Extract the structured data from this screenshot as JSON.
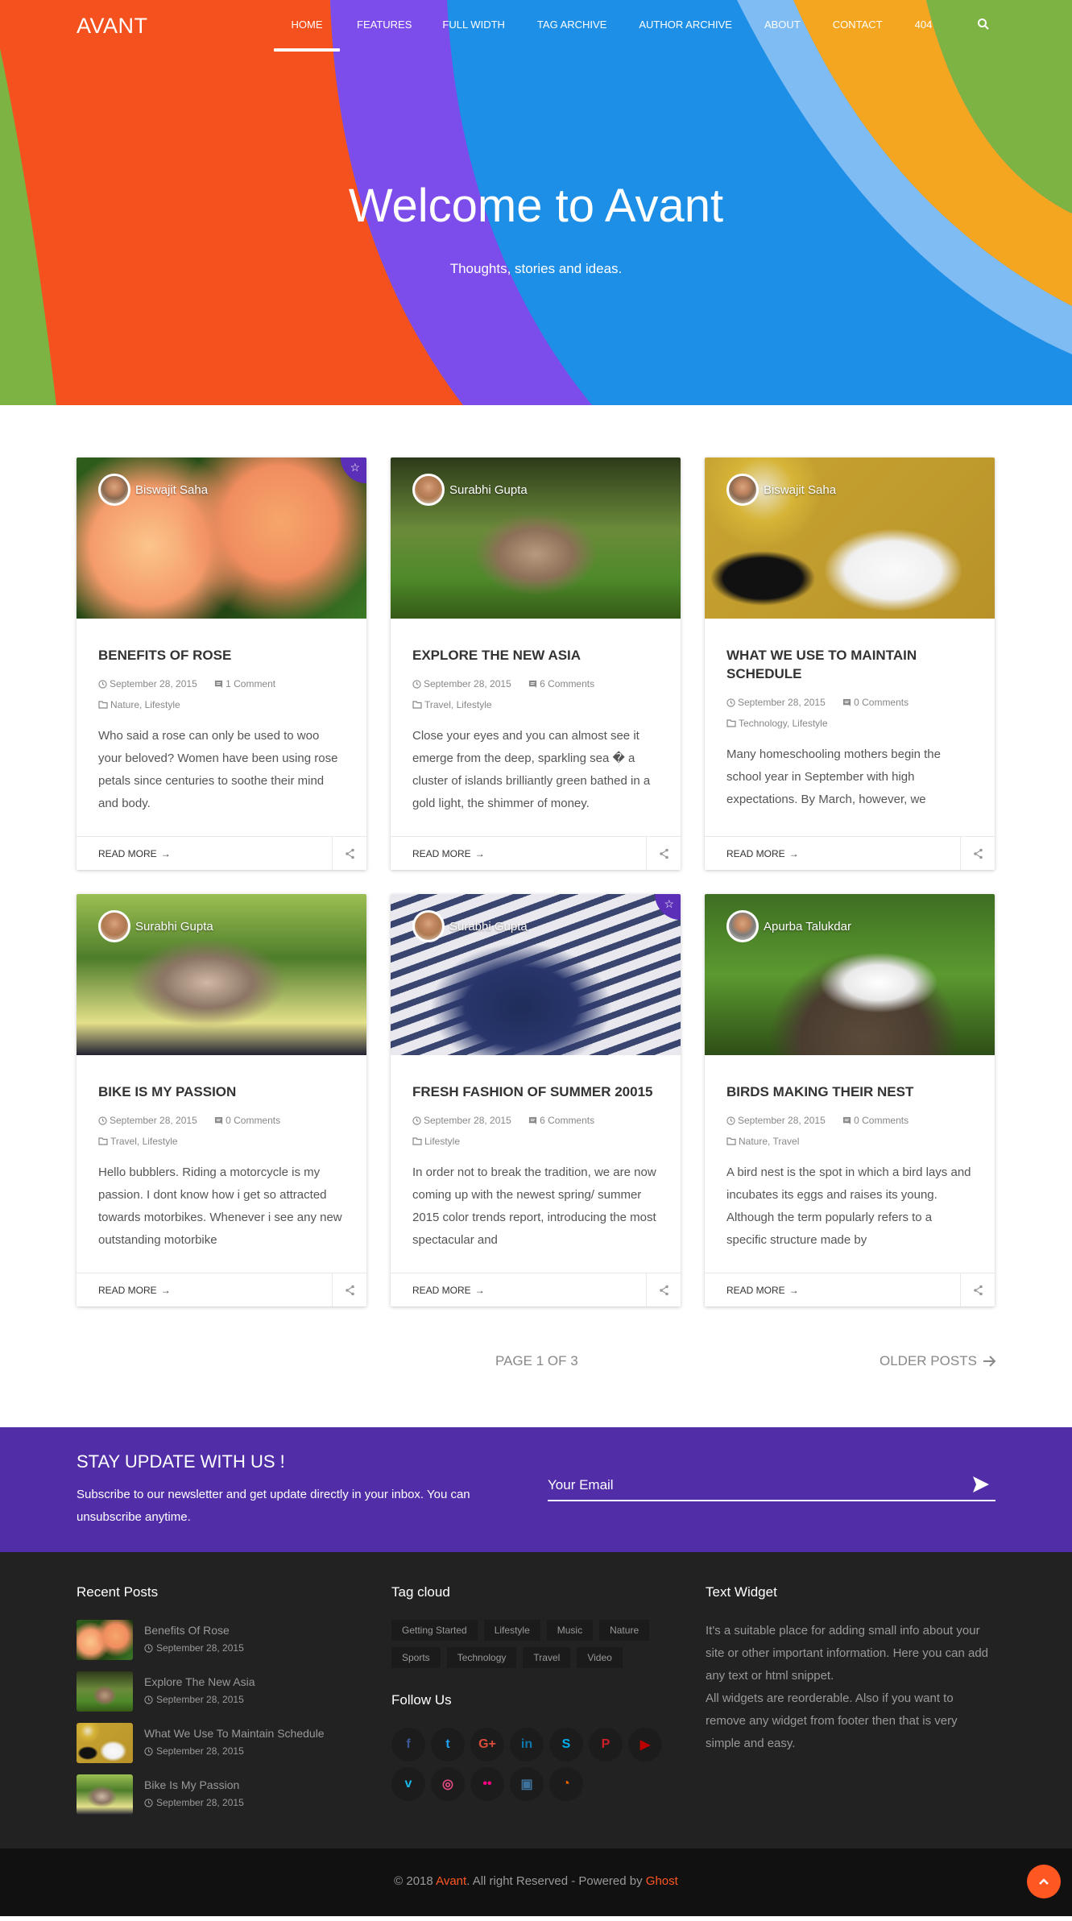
{
  "site": {
    "logo": "AVANT",
    "brand_color": "#512da8",
    "accent_color": "#ff5722"
  },
  "nav": {
    "items": [
      {
        "label": "HOME",
        "active": true
      },
      {
        "label": "FEATURES"
      },
      {
        "label": "FULL WIDTH"
      },
      {
        "label": "TAG ARCHIVE"
      },
      {
        "label": "AUTHOR ARCHIVE"
      },
      {
        "label": "ABOUT"
      },
      {
        "label": "CONTACT"
      },
      {
        "label": "404"
      }
    ],
    "search_icon": "search-icon"
  },
  "hero": {
    "title": "Welcome to Avant",
    "subtitle": "Thoughts, stories and ideas."
  },
  "posts": [
    {
      "author": "Biswajit Saha",
      "featured": true,
      "title": "BENEFITS OF ROSE",
      "date": "September 28, 2015",
      "comments": "1 Comment",
      "tags": "Nature, Lifestyle",
      "excerpt": "Who said a rose can only be used to woo your beloved? Women have been using rose petals since centuries to soothe their mind and body.",
      "read_more": "READ MORE"
    },
    {
      "author": "Surabhi Gupta",
      "featured": false,
      "title": "EXPLORE THE NEW ASIA",
      "date": "September 28, 2015",
      "comments": "6 Comments",
      "tags": "Travel, Lifestyle",
      "excerpt": "Close your eyes and you can almost see it emerge from the deep, sparkling sea � a cluster of islands brilliantly green bathed in a gold light, the shimmer of money.",
      "read_more": "READ MORE"
    },
    {
      "author": "Biswajit Saha",
      "featured": false,
      "title": "WHAT WE USE TO MAINTAIN SCHEDULE",
      "date": "September 28, 2015",
      "comments": "0 Comments",
      "tags": "Technology, Lifestyle",
      "excerpt": "Many homeschooling mothers begin the school year in September with high expectations. By March, however, we",
      "read_more": "READ MORE"
    },
    {
      "author": "Surabhi Gupta",
      "featured": false,
      "title": "BIKE IS MY PASSION",
      "date": "September 28, 2015",
      "comments": "0 Comments",
      "tags": "Travel, Lifestyle",
      "excerpt": "Hello bubblers. Riding a motorcycle is my passion. I dont know how i get so attracted towards motorbikes. Whenever i see any new outstanding motorbike",
      "read_more": "READ MORE"
    },
    {
      "author": "Surabhi Gupta",
      "featured": true,
      "title": "FRESH FASHION OF SUMMER 20015",
      "date": "September 28, 2015",
      "comments": "6 Comments",
      "tags": "Lifestyle",
      "excerpt": "In order not to break the tradition, we are now coming up with the newest spring/ summer 2015 color trends report, introducing the most spectacular and",
      "read_more": "READ MORE"
    },
    {
      "author": "Apurba Talukdar",
      "featured": false,
      "title": "BIRDS MAKING THEIR NEST",
      "date": "September 28, 2015",
      "comments": "0 Comments",
      "tags": "Nature, Travel",
      "excerpt": "A bird nest is the spot in which a bird lays and incubates its eggs and raises its young. Although the term popularly refers to a specific structure made by",
      "read_more": "READ MORE"
    }
  ],
  "pagination": {
    "page_label": "PAGE 1 OF 3",
    "older_label": "OLDER POSTS"
  },
  "newsletter": {
    "title": "STAY UPDATE WITH US !",
    "text": "Subscribe to our newsletter and get update directly in your inbox. You can unsubscribe anytime.",
    "email_placeholder": "Your Email"
  },
  "footer": {
    "recent_title": "Recent Posts",
    "recent": [
      {
        "title": "Benefits Of Rose",
        "date": "September 28, 2015"
      },
      {
        "title": "Explore The New Asia",
        "date": "September 28, 2015"
      },
      {
        "title": "What We Use To Maintain Schedule",
        "date": "September 28, 2015"
      },
      {
        "title": "Bike Is My Passion",
        "date": "September 28, 2015"
      }
    ],
    "tag_title": "Tag cloud",
    "tags": [
      "Getting Started",
      "Lifestyle",
      "Music",
      "Nature",
      "Sports",
      "Technology",
      "Travel",
      "Video"
    ],
    "follow_title": "Follow Us",
    "social": [
      {
        "name": "facebook",
        "glyph": "f",
        "color": "#3b5998"
      },
      {
        "name": "twitter",
        "glyph": "t",
        "color": "#1da1f2"
      },
      {
        "name": "google-plus",
        "glyph": "G+",
        "color": "#dd4b39"
      },
      {
        "name": "linkedin",
        "glyph": "in",
        "color": "#0e76a8"
      },
      {
        "name": "skype",
        "glyph": "S",
        "color": "#00aff0"
      },
      {
        "name": "pinterest",
        "glyph": "P",
        "color": "#cb2027"
      },
      {
        "name": "youtube",
        "glyph": "▶",
        "color": "#bb0000"
      },
      {
        "name": "vimeo",
        "glyph": "v",
        "color": "#1ab7ea"
      },
      {
        "name": "dribbble",
        "glyph": "◎",
        "color": "#ea4c89"
      },
      {
        "name": "flickr",
        "glyph": "••",
        "color": "#ff0084"
      },
      {
        "name": "instagram",
        "glyph": "▣",
        "color": "#3f729b"
      },
      {
        "name": "rss",
        "glyph": "◔",
        "color": "#ff6600"
      }
    ],
    "widget_title": "Text Widget",
    "widget_text_1": "It's a suitable place for adding small info about your site or other important information. Here you can add any text or html snippet.",
    "widget_text_2": "All widgets are reorderable. Also if you want to remove any widget from footer then that is very simple and easy."
  },
  "copyright": {
    "prefix": "© 2018 ",
    "brand": "Avant",
    "middle": ". All right Reserved - Powered by ",
    "powered": "Ghost"
  }
}
